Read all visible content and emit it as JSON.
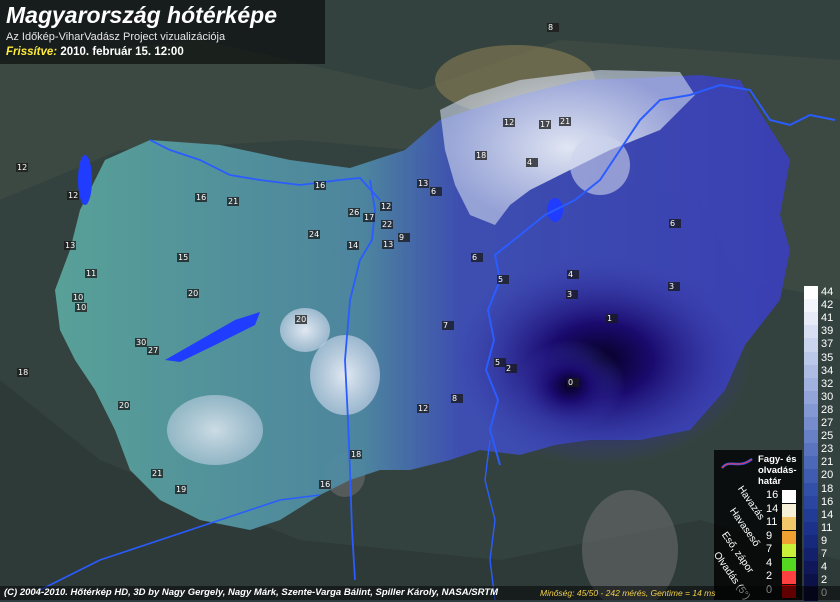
{
  "header": {
    "title": "Magyarország hótérképe",
    "subtitle": "Az Időkép-ViharVadász Project vizualizációja",
    "updated_label": "Frissítve:",
    "updated_value": "2010. február 15. 12:00"
  },
  "scale": {
    "values": [
      "44",
      "42",
      "41",
      "39",
      "37",
      "35",
      "34",
      "32",
      "30",
      "28",
      "27",
      "25",
      "23",
      "21",
      "20",
      "18",
      "16",
      "14",
      "11",
      "9",
      "7",
      "4",
      "2",
      "0"
    ]
  },
  "legend": {
    "frost_line_label": "Fagy- és olvadás-határ",
    "categories": [
      "Havazás",
      "Havaseső",
      "Eső, zápor",
      "Olvadás (5°)"
    ],
    "category_values": [
      "16",
      "14",
      "11",
      "9",
      "7",
      "4",
      "2",
      "0"
    ]
  },
  "footer": {
    "copyright": "(C) 2004-2010. Hőtérkép HD, 3D by Nagy Gergely, Nagy Márk, Szente-Varga Bálint, Spiller Károly, NASA/SRTM",
    "quality": "Minőség: 45/50 - 242 mérés, Gentime = 14 ms"
  },
  "stations": [
    {
      "v": "8"
    },
    {
      "v": "12"
    },
    {
      "v": "16"
    },
    {
      "v": "21"
    },
    {
      "v": "16"
    },
    {
      "v": "12"
    },
    {
      "v": "13"
    },
    {
      "v": "15"
    },
    {
      "v": "11"
    },
    {
      "v": "10"
    },
    {
      "v": "10"
    },
    {
      "v": "20"
    },
    {
      "v": "30"
    },
    {
      "v": "27"
    },
    {
      "v": "18"
    },
    {
      "v": "20"
    },
    {
      "v": "24"
    },
    {
      "v": "26"
    },
    {
      "v": "17"
    },
    {
      "v": "22"
    },
    {
      "v": "12"
    },
    {
      "v": "14"
    },
    {
      "v": "13"
    },
    {
      "v": "9"
    },
    {
      "v": "20"
    },
    {
      "v": "13"
    },
    {
      "v": "6"
    },
    {
      "v": "12"
    },
    {
      "v": "17"
    },
    {
      "v": "21"
    },
    {
      "v": "18"
    },
    {
      "v": "4"
    },
    {
      "v": "6"
    },
    {
      "v": "6"
    },
    {
      "v": "5"
    },
    {
      "v": "4"
    },
    {
      "v": "3"
    },
    {
      "v": "3"
    },
    {
      "v": "1"
    },
    {
      "v": "7"
    },
    {
      "v": "5"
    },
    {
      "v": "2"
    },
    {
      "v": "0"
    },
    {
      "v": "8"
    },
    {
      "v": "12"
    },
    {
      "v": "18"
    },
    {
      "v": "16"
    },
    {
      "v": "21"
    },
    {
      "v": "19"
    }
  ],
  "colors": {
    "frost_line": "#2a5cff",
    "snow_max": "#ffffff",
    "snow_min": "#0a0030"
  }
}
